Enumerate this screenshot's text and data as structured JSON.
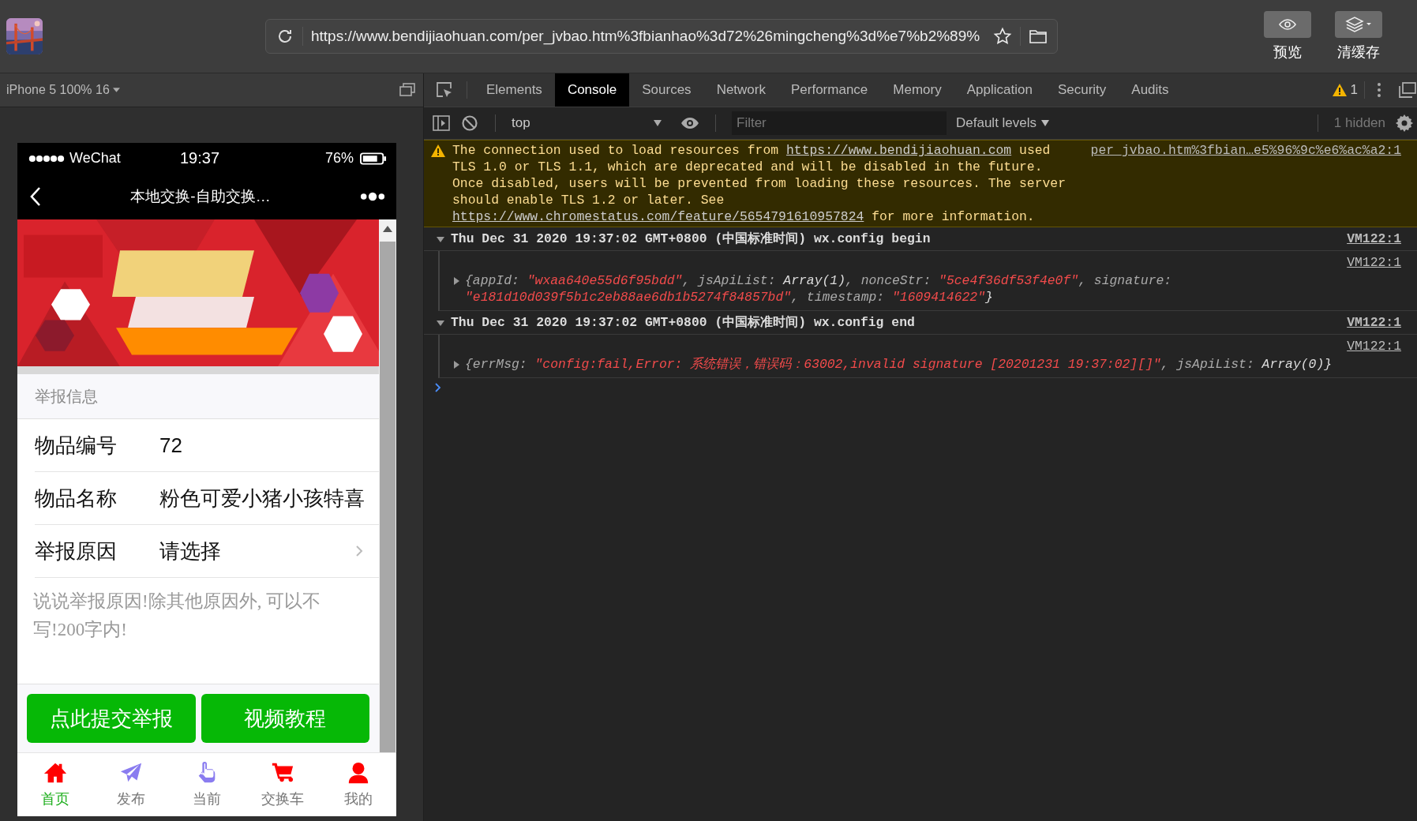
{
  "address_bar": {
    "url": "https://www.bendijiaohuan.com/per_jvbao.htm%3fbianhao%3d72%26mingcheng%3d%e7%b2%89%"
  },
  "toolbar_buttons": [
    {
      "label": "预览",
      "kind": "preview"
    },
    {
      "label": "清缓存",
      "kind": "clear-cache"
    }
  ],
  "device_bar": {
    "device": "iPhone 5 100% 16"
  },
  "devtools": {
    "tabs": [
      {
        "label": "Elements",
        "selected": false
      },
      {
        "label": "Console",
        "selected": true
      },
      {
        "label": "Sources",
        "selected": false
      },
      {
        "label": "Network",
        "selected": false
      },
      {
        "label": "Performance",
        "selected": false
      },
      {
        "label": "Memory",
        "selected": false
      },
      {
        "label": "Application",
        "selected": false
      },
      {
        "label": "Security",
        "selected": false
      },
      {
        "label": "Audits",
        "selected": false
      }
    ],
    "warning_count": "1",
    "console_toolbar": {
      "context": "top",
      "filter_placeholder": "Filter",
      "levels": "Default levels",
      "hidden": "1 hidden"
    },
    "messages": [
      {
        "kind": "warning",
        "source": "per_jvbao.htm%3fbian…e5%96%9c%e6%ac%a2:1",
        "segments": [
          {
            "text": "The connection used to load resources from ",
            "kind": "text"
          },
          {
            "text": "https://www.bendijiaohuan.com",
            "kind": "link"
          },
          {
            "text": " used TLS 1.0 or TLS 1.1, which are deprecated and will be disabled in the future. Once disabled, users will be prevented from loading these resources. The server should enable TLS 1.2 or later. See ",
            "kind": "text"
          },
          {
            "text": "https://www.chromestatus.com/feature/5654791610957824",
            "kind": "link"
          },
          {
            "text": " for more information.",
            "kind": "text"
          }
        ]
      },
      {
        "kind": "group",
        "expanded": true,
        "text": "Thu Dec 31 2020 19:37:02 GMT+0800 (中国标准时间) wx.config begin",
        "source": "VM122:1"
      },
      {
        "kind": "object",
        "expanded": false,
        "source": "VM122:1",
        "tokens": [
          {
            "text": "{appId: ",
            "kind": "key"
          },
          {
            "text": "\"wxaa640e55d6f95bdd\"",
            "kind": "string"
          },
          {
            "text": ", jsApiList: ",
            "kind": "key"
          },
          {
            "text": "Array(1)",
            "kind": "plain"
          },
          {
            "text": ", nonceStr: ",
            "kind": "key"
          },
          {
            "text": "\"5ce4f36df53f4e0f\"",
            "kind": "string"
          },
          {
            "text": ", signature: ",
            "kind": "key"
          },
          {
            "text": "\"e181d10d039f5b1c2eb88ae6db1b5274f84857bd\"",
            "kind": "string"
          },
          {
            "text": ", timestamp: ",
            "kind": "key"
          },
          {
            "text": "\"1609414622\"",
            "kind": "string"
          },
          {
            "text": "}",
            "kind": "plain"
          }
        ]
      },
      {
        "kind": "group",
        "expanded": true,
        "text": "Thu Dec 31 2020 19:37:02 GMT+0800 (中国标准时间) wx.config end",
        "source": "VM122:1"
      },
      {
        "kind": "object",
        "expanded": false,
        "source": "VM122:1",
        "tokens": [
          {
            "text": "{errMsg: ",
            "kind": "key"
          },
          {
            "text": "\"config:fail,Error: 系统错误，错误码：63002,invalid signature [20201231 19:37:02][]\"",
            "kind": "string"
          },
          {
            "text": ", jsApiList: ",
            "kind": "key"
          },
          {
            "text": "Array(0)",
            "kind": "plain"
          },
          {
            "text": "}",
            "kind": "plain"
          }
        ]
      }
    ]
  },
  "phone": {
    "status_bar": {
      "carrier": "WeChat",
      "time": "19:37",
      "battery": "76%"
    },
    "nav_title": "本地交换-自助交换…",
    "section_title": "举报信息",
    "fields": [
      {
        "label": "物品编号",
        "value": "72",
        "kind": "text"
      },
      {
        "label": "物品名称",
        "value": "粉色可爱小猪小孩特喜",
        "kind": "text"
      },
      {
        "label": "举报原因",
        "value": "请选择",
        "kind": "select"
      }
    ],
    "reason_placeholder": "说说举报原因!除其他原因外, 可以不写!200字内!",
    "buttons": [
      "点此提交举报",
      "视频教程"
    ],
    "tab_bar": [
      {
        "label": "首页",
        "kind": "home",
        "color": "#ff0000",
        "selected": true
      },
      {
        "label": "发布",
        "kind": "send",
        "color": "#8a7cf0",
        "selected": false
      },
      {
        "label": "当前",
        "kind": "hand",
        "color": "#8a7cf0",
        "selected": false
      },
      {
        "label": "交换车",
        "kind": "cart",
        "color": "#ff0000",
        "selected": false
      },
      {
        "label": "我的",
        "kind": "user",
        "color": "#ff0000",
        "selected": false
      }
    ]
  }
}
